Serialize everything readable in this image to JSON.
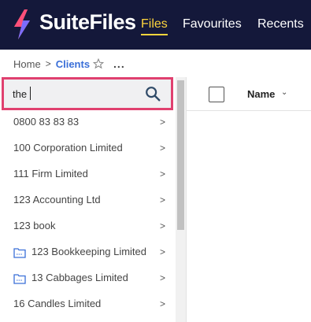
{
  "app": {
    "brand": "SuiteFiles",
    "nav": [
      {
        "label": "Files",
        "active": true
      },
      {
        "label": "Favourites",
        "active": false
      },
      {
        "label": "Recents",
        "active": false
      }
    ],
    "colors": {
      "topbar": "#14183a",
      "active_nav": "#ffd53d",
      "link": "#3a6fd8",
      "highlight_border": "#e0406f"
    }
  },
  "breadcrumb": {
    "home": "Home",
    "separator": ">",
    "current": "Clients",
    "more": "..."
  },
  "search": {
    "value": "the",
    "icon": "search-icon"
  },
  "list": {
    "items": [
      {
        "label": "0800 83 83 83",
        "icon": null
      },
      {
        "label": "100 Corporation Limited",
        "icon": null
      },
      {
        "label": "111 Firm Limited",
        "icon": null
      },
      {
        "label": "123 Accounting Ltd",
        "icon": null
      },
      {
        "label": "123 book",
        "icon": null
      },
      {
        "label": "123 Bookkeeping Limited",
        "icon": "shared-folder-icon"
      },
      {
        "label": "13 Cabbages Limited",
        "icon": "shared-folder-icon"
      },
      {
        "label": "16 Candles Limited",
        "icon": null
      }
    ],
    "chevron": ">"
  },
  "table": {
    "columns": [
      {
        "label": "Name",
        "sort_icon": "chevron-down-icon"
      }
    ]
  }
}
